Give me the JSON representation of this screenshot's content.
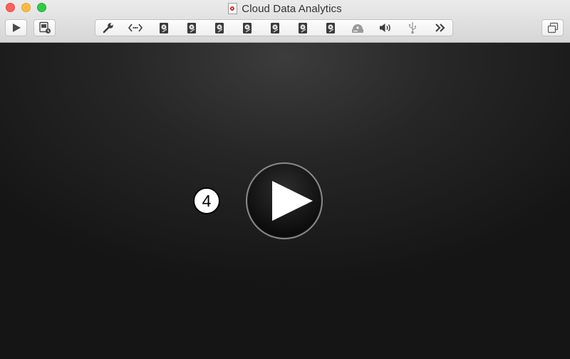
{
  "window": {
    "title": "Cloud Data Analytics",
    "title_icon": "vm-document-icon"
  },
  "colors": {
    "close": "#fc605c",
    "minimize": "#fdbc40",
    "maximize": "#34c84a",
    "vm_background": "#161616"
  },
  "toolbar": {
    "left_buttons": [
      "play-icon",
      "snapshot-icon"
    ],
    "devices": [
      "wrench-icon",
      "network-icon",
      "hard-disk-icon",
      "hard-disk-icon",
      "hard-disk-icon",
      "hard-disk-icon",
      "hard-disk-icon",
      "hard-disk-icon",
      "hard-disk-icon",
      "optical-drive-icon",
      "sound-icon",
      "usb-icon",
      "more-chevrons-icon"
    ],
    "right_button": "fullscreen-icon"
  },
  "vm": {
    "play_button": "play-icon",
    "badge_number": "4"
  }
}
